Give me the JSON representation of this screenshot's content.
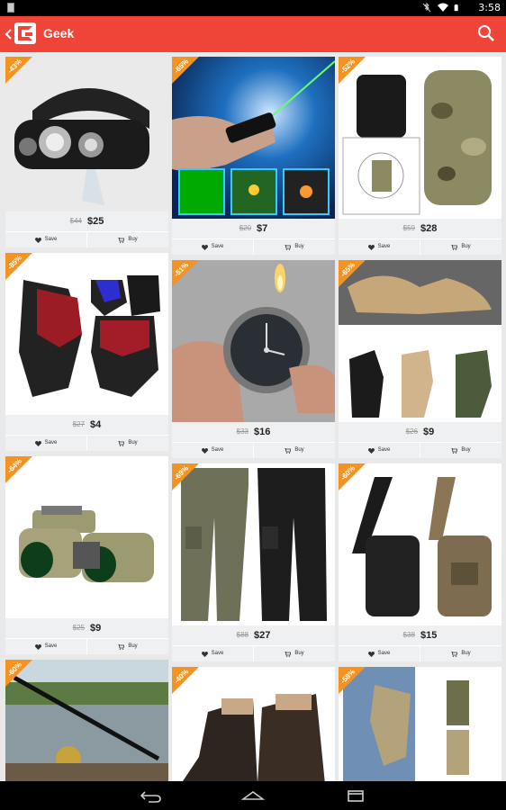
{
  "status_bar": {
    "time": "3:58"
  },
  "app_bar": {
    "title": "Geek"
  },
  "products": [
    {
      "discount": "-43%",
      "old_price": "$44",
      "price": "$25"
    },
    {
      "discount": "-65%",
      "old_price": "$20",
      "price": "$7"
    },
    {
      "discount": "-52%",
      "old_price": "$59",
      "price": "$28"
    },
    {
      "discount": "-85%",
      "old_price": "$27",
      "price": "$4"
    },
    {
      "discount": "-51%",
      "old_price": "$33",
      "price": "$16"
    },
    {
      "discount": "-65%",
      "old_price": "$26",
      "price": "$9"
    },
    {
      "discount": "-64%",
      "old_price": "$25",
      "price": "$9"
    },
    {
      "discount": "-69%",
      "old_price": "$88",
      "price": "$27"
    },
    {
      "discount": "-60%",
      "old_price": "$38",
      "price": "$15"
    },
    {
      "discount": "-60%"
    },
    {
      "discount": "-40%"
    },
    {
      "discount": "-58%"
    }
  ],
  "actions": {
    "save": "Save",
    "buy": "Buy"
  },
  "colors": {
    "brand": "#ef4438",
    "badge": "#f39321"
  },
  "icons": [
    "back-arrow-icon",
    "geek-logo-icon",
    "search-icon",
    "heart-icon",
    "cart-icon",
    "nav-back-icon",
    "nav-home-icon",
    "nav-recents-icon"
  ]
}
